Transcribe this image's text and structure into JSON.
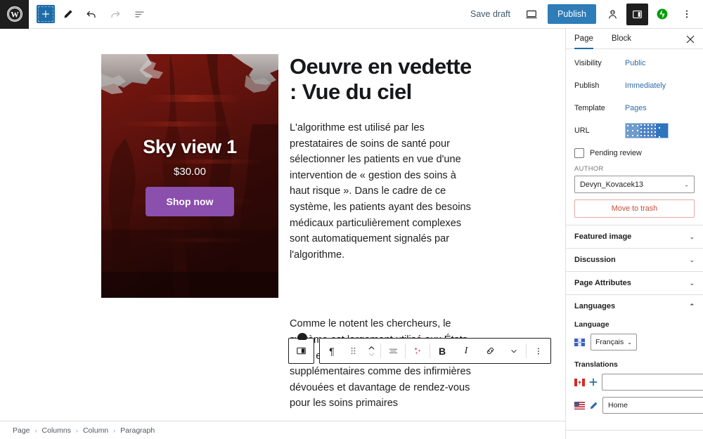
{
  "topbar": {
    "logo_icon": "wordpress-logo-icon",
    "add_block_icon": "plus-icon",
    "edit_tool_icon": "pencil-icon",
    "undo_icon": "undo-arrow-icon",
    "redo_icon": "redo-arrow-icon",
    "list_view_icon": "list-view-icon",
    "save_draft_label": "Save draft",
    "preview_icon": "desktop-preview-icon",
    "publish_label": "Publish",
    "account_icon": "user-avatar-icon",
    "settings_toggle_icon": "settings-sidebar-icon",
    "jetpack_icon": "jetpack-icon",
    "more_options_icon": "vertical-dots-icon",
    "publish_button_color": "#2e7cb8",
    "jetpack_color": "#069e08"
  },
  "canvas": {
    "cover": {
      "title": "Sky view 1",
      "price": "$30.00",
      "button_label": "Shop now",
      "button_color": "#8b4fae",
      "background_color": "#4d0f0b"
    },
    "post_title": "Oeuvre en vedette : Vue du ciel",
    "paragraph_1": "L'algorithme est utilisé par les prestataires de soins de santé pour sélectionner les patients en vue d'une intervention de « gestion des soins à haut risque ». Dans le cadre de ce système, les patients ayant des besoins médicaux particulièrement complexes sont automatiquement signalés par l'algorithme.",
    "paragraph_2": "Comme le notent les chercheurs, le système est largement utilisé aux États-Unis, et pour cause. Des avantages supplémentaires comme des infirmières dévouées et davantage de rendez-vous pour les soins primaires"
  },
  "block_toolbar": {
    "columns_icon": "columns-block-icon",
    "block_type_icon": "paragraph-icon",
    "drag_icon": "drag-handle-icon",
    "move_icon": "move-up-down-icon",
    "align_icon": "align-text-icon",
    "ai_icon": "ai-sparkle-icon",
    "ai_color": "#d4455a",
    "bold_label": "B",
    "italic_label": "I",
    "link_icon": "link-icon",
    "more_formats_icon": "chevron-down-icon",
    "options_icon": "vertical-dots-icon"
  },
  "breadcrumb": {
    "items": [
      "Page",
      "Columns",
      "Column",
      "Paragraph"
    ],
    "separator": "›"
  },
  "sidebar": {
    "tabs": [
      {
        "label": "Page",
        "active": true
      },
      {
        "label": "Block",
        "active": false
      }
    ],
    "close_icon": "close-icon",
    "status_rows": [
      {
        "label": "Visibility",
        "value": "Public"
      },
      {
        "label": "Publish",
        "value": "Immediately"
      },
      {
        "label": "Template",
        "value": "Pages"
      }
    ],
    "url_label": "URL",
    "url_placeholder_icon": "loading-skeleton",
    "pending_review_label": "Pending review",
    "author_heading": "AUTHOR",
    "author_value": "Devyn_Kovacek13",
    "trash_label": "Move to trash",
    "trash_color": "#cc4b37",
    "panels": [
      {
        "label": "Featured image",
        "expanded": false
      },
      {
        "label": "Discussion",
        "expanded": false
      },
      {
        "label": "Page Attributes",
        "expanded": false
      }
    ],
    "languages": {
      "panel_label": "Languages",
      "expanded": true,
      "language_label": "Language",
      "language_flag_icon": "france-flag-icon",
      "language_value": "Français",
      "translations_label": "Translations",
      "translations": [
        {
          "flag_icon": "canada-flag-icon",
          "action_icon": "plus-icon",
          "value": "",
          "placeholder": ""
        },
        {
          "flag_icon": "usa-flag-icon",
          "action_icon": "pencil-icon",
          "value": "Home",
          "placeholder": "Home"
        }
      ]
    }
  }
}
